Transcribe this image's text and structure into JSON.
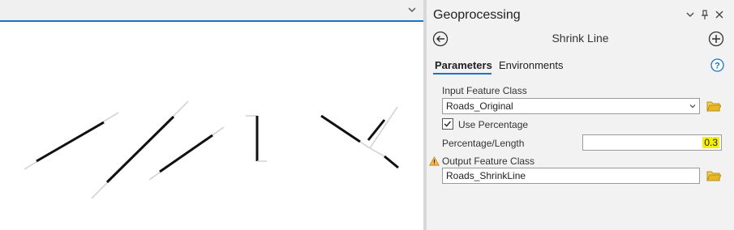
{
  "pane": {
    "title": "Geoprocessing",
    "tool_title": "Shrink Line",
    "tabs": {
      "parameters": "Parameters",
      "environments": "Environments"
    },
    "help_icon": "?"
  },
  "params": {
    "input_label": "Input Feature Class",
    "input_value": "Roads_Original",
    "use_percentage_label": "Use Percentage",
    "use_percentage_checked": true,
    "percentage_label": "Percentage/Length",
    "percentage_value": "0.3",
    "output_label": "Output Feature Class",
    "output_value": "Roads_ShrinkLine"
  },
  "colors": {
    "accent": "#1a73c8",
    "highlight": "#f4f000",
    "warning": "#e8a317",
    "folder": "#e6b829"
  },
  "icons": [
    "chevron-down-icon",
    "pin-icon",
    "close-icon",
    "back-icon",
    "add-icon",
    "help-icon",
    "folder-icon",
    "warning-icon",
    "checkbox-icon"
  ]
}
